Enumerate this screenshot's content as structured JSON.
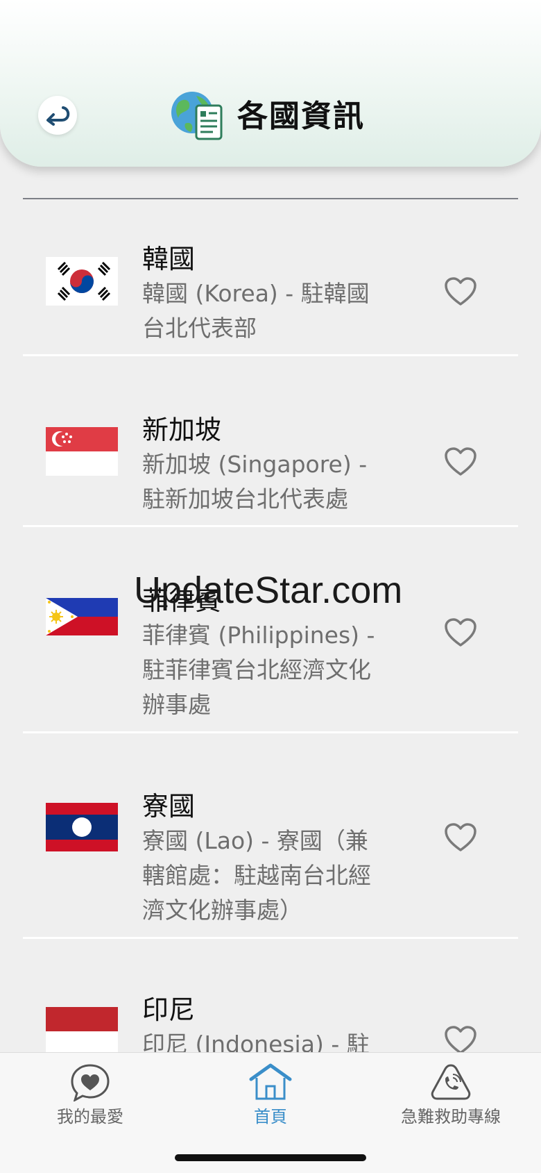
{
  "header": {
    "title": "各國資訊"
  },
  "countries": [
    {
      "name": "韓國",
      "description": "韓國 (Korea) - 駐韓國\n台北代表部",
      "flag": "korea-flag-icon"
    },
    {
      "name": "新加坡",
      "description": "新加坡 (Singapore) -\n駐新加坡台北代表處",
      "flag": "singapore-flag-icon"
    },
    {
      "name": "菲律賓",
      "description": "菲律賓 (Philippines) -\n駐菲律賓台北經濟文化\n辦事處",
      "flag": "philippines-flag-icon"
    },
    {
      "name": "寮國",
      "description": "寮國 (Lao) - 寮國（兼\n轄館處：駐越南台北經\n濟文化辦事處）",
      "flag": "laos-flag-icon"
    },
    {
      "name": "印尼",
      "description": "印尼 (Indonesia) - 駐",
      "flag": "indonesia-flag-icon"
    }
  ],
  "watermark": "UpdateStar.com",
  "bottom_nav": {
    "items": [
      {
        "label": "我的最愛",
        "icon": "heart-chat-icon",
        "active": false
      },
      {
        "label": "首頁",
        "icon": "home-icon",
        "active": true
      },
      {
        "label": "急難救助專線",
        "icon": "phone-icon",
        "active": false
      }
    ]
  },
  "colors": {
    "accent": "#3a8ec9",
    "background": "#efefef",
    "header_gradient_end": "#dfeee7",
    "secondary_text": "#6e6e6e"
  }
}
